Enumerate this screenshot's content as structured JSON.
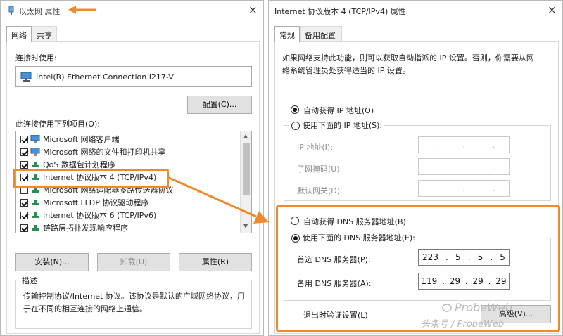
{
  "left_window": {
    "title": "以太网 属性",
    "close": "×",
    "tabs": [
      "网络",
      "共享"
    ],
    "connect_using_label": "连接时使用:",
    "adapter_name": "Intel(R) Ethernet Connection I217-V",
    "configure_button": "配置(C)...",
    "items_label": "此连接使用下列项目(O):",
    "items": [
      {
        "label": "Microsoft 网络客户端",
        "checked": true,
        "icon": "network-client-icon"
      },
      {
        "label": "Microsoft 网络的文件和打印机共享",
        "checked": true,
        "icon": "file-printer-sharing-icon"
      },
      {
        "label": "QoS 数据包计划程序",
        "checked": true,
        "icon": "qos-icon"
      },
      {
        "label": "Internet 协议版本 4 (TCP/IPv4)",
        "checked": true,
        "icon": "protocol-icon"
      },
      {
        "label": "Microsoft 网络适配器多路传送器协议",
        "checked": false,
        "icon": "protocol-icon"
      },
      {
        "label": "Microsoft LLDP 协议驱动程序",
        "checked": true,
        "icon": "protocol-icon"
      },
      {
        "label": "Internet 协议版本 6 (TCP/IPv6)",
        "checked": true,
        "icon": "protocol-icon"
      },
      {
        "label": "链路层拓扑发现响应程序",
        "checked": true,
        "icon": "protocol-icon"
      }
    ],
    "install_button": "安装(N)...",
    "uninstall_button": "卸载(U)",
    "properties_button": "属性(R)",
    "description_title": "描述",
    "description_text_1": "传输控制协议/Internet 协议。该协议是默认的广域网络协议，用",
    "description_text_2": "于在不同的相互连接的网络上通信。"
  },
  "right_window": {
    "title": "Internet 协议版本 4 (TCP/IPv4) 属性",
    "close": "×",
    "tabs": [
      "常规",
      "备用配置"
    ],
    "intro_1": "如果网络支持此功能，则可以获取自动指派的 IP 设置。否则，你需要从网",
    "intro_2": "络系统管理员处获得适当的 IP 设置。",
    "auto_ip": "自动获得 IP 地址(O)",
    "manual_ip": "使用下面的 IP 地址(S):",
    "ip_address_label": "IP 地址(I):",
    "subnet_label": "子网掩码(U):",
    "gateway_label": "默认网关(D):",
    "auto_dns": "自动获得 DNS 服务器地址(B)",
    "manual_dns": "使用下面的 DNS 服务器地址(E):",
    "preferred_dns_label": "首选 DNS 服务器(P):",
    "preferred_dns": [
      "223",
      "5",
      "5",
      "5"
    ],
    "alternate_dns_label": "备用 DNS 服务器(A):",
    "alternate_dns": [
      "119",
      "29",
      "29",
      "29"
    ],
    "validate_label": "退出时验证设置(L)",
    "advanced_button": "高级(V)..."
  },
  "watermark": {
    "brand": "ProbeWeb",
    "source": "头条号 / ProbeWeb"
  },
  "accent_color": "#f0892b"
}
